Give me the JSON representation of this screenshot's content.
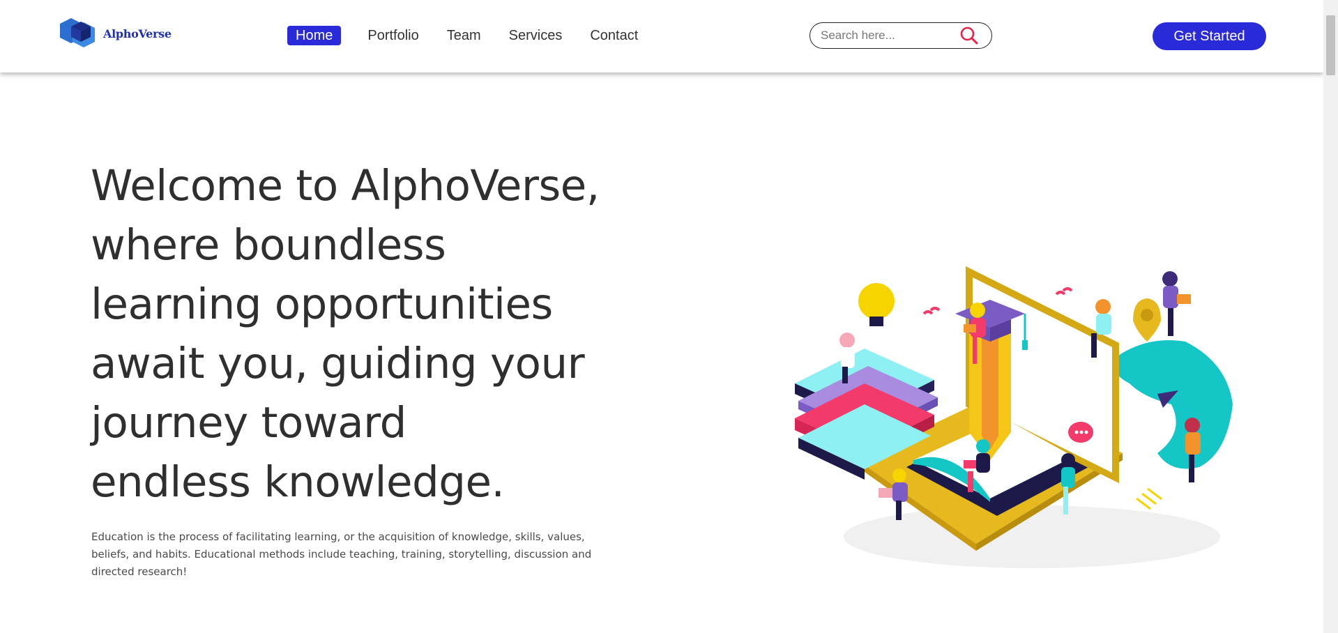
{
  "brand": {
    "name": "AlphoVerse"
  },
  "nav": {
    "items": [
      {
        "label": "Home",
        "active": true
      },
      {
        "label": "Portfolio",
        "active": false
      },
      {
        "label": "Team",
        "active": false
      },
      {
        "label": "Services",
        "active": false
      },
      {
        "label": "Contact",
        "active": false
      }
    ]
  },
  "search": {
    "placeholder": "Search here...",
    "value": ""
  },
  "cta": {
    "label": "Get Started"
  },
  "hero": {
    "title_lines": [
      "Welcome to AlphoVerse,",
      "where boundless",
      "learning opportunities",
      "await you, guiding your",
      "journey toward",
      "endless knowledge."
    ],
    "text_lines": [
      "Education is the process of facilitating learning, or the acquisition of knowledge, skills, values,",
      "beliefs, and habits. Educational methods include teaching, training, storytelling, discussion and",
      "directed research!"
    ]
  },
  "colors": {
    "accent": "#2a2ad8",
    "search_icon": "#e0244a",
    "text": "#2f2f2f",
    "illustration_yellow": "#e6b91e",
    "illustration_teal": "#14c6c6",
    "illustration_purple": "#6a4fb5",
    "illustration_pink": "#f23b6a"
  },
  "icons": {
    "logo": "hexagon-cube-logo-icon",
    "search": "search-icon"
  },
  "illustration": {
    "name": "isometric-education-illustration"
  }
}
